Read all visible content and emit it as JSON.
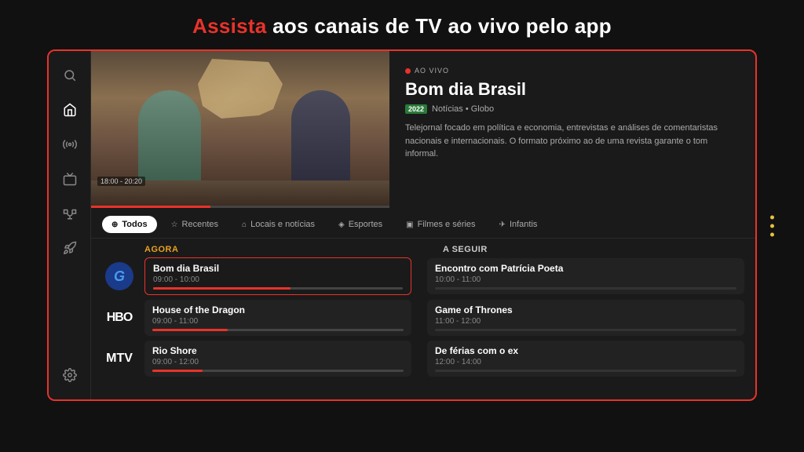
{
  "header": {
    "accent": "Assista",
    "rest": " aos canais de TV ao vivo pelo app"
  },
  "sidebar": {
    "icons": [
      {
        "name": "search-icon",
        "label": "Search"
      },
      {
        "name": "home-icon",
        "label": "Home"
      },
      {
        "name": "live-icon",
        "label": "Live"
      },
      {
        "name": "tv-icon",
        "label": "TV"
      },
      {
        "name": "trophy-icon",
        "label": "Trophy"
      },
      {
        "name": "rocket-icon",
        "label": "Rocket"
      },
      {
        "name": "gear-icon",
        "label": "Settings"
      }
    ]
  },
  "video": {
    "time_range": "18:00 - 20:20"
  },
  "info": {
    "live_label": "AO VIVO",
    "show_title": "Bom dia Brasil",
    "year": "2022",
    "category": "Notícias • Globo",
    "description": "Telejornal focado em política e economia, entrevistas e análises de comentaristas nacionais e internacionais. O formato próximo ao de uma revista garante o tom informal."
  },
  "tabs": [
    {
      "label": "Todos",
      "icon": "⊕",
      "active": true
    },
    {
      "label": "Recentes",
      "icon": "☆",
      "active": false
    },
    {
      "label": "Locais e notícias",
      "icon": "⌂",
      "active": false
    },
    {
      "label": "Esportes",
      "icon": "◈",
      "active": false
    },
    {
      "label": "Filmes e séries",
      "icon": "▣",
      "active": false
    },
    {
      "label": "Infantis",
      "icon": "✈",
      "active": false
    }
  ],
  "columns": {
    "agora": "AGORA",
    "a_seguir": "A SEGUIR"
  },
  "channels": [
    {
      "logo": "globo",
      "now_title": "Bom dia  Brasil",
      "now_time": "09:00 - 10:00",
      "now_progress": 55,
      "next_title": "Encontro com Patrícia Poeta",
      "next_time": "10:00 - 11:00",
      "selected": true
    },
    {
      "logo": "hbo",
      "now_title": "House of the Dragon",
      "now_time": "09:00 - 11:00",
      "now_progress": 30,
      "next_title": "Game of Thrones",
      "next_time": "11:00 - 12:00",
      "selected": false
    },
    {
      "logo": "mtv",
      "now_title": "Rio Shore",
      "now_time": "09:00 - 12:00",
      "now_progress": 20,
      "next_title": "De férias com o ex",
      "next_time": "12:00 - 14:00",
      "selected": false
    }
  ]
}
